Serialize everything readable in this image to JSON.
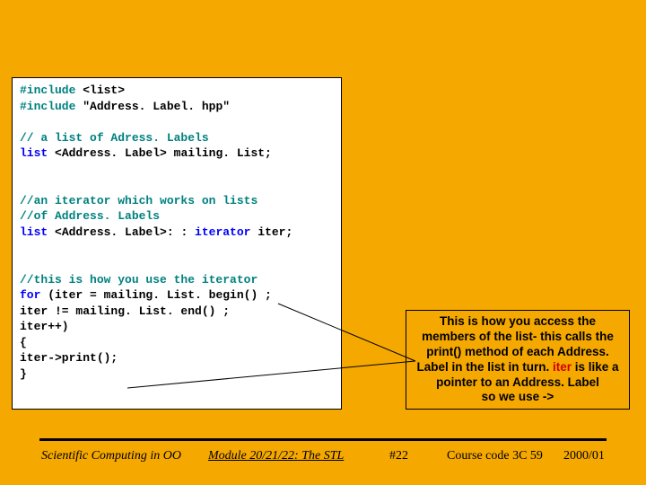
{
  "code": {
    "l1a": "#include",
    "l1b": " <list>",
    "l2a": "#include",
    "l2b": " \"Address. Label. hpp\"",
    "c1": "// a list of Adress. Labels",
    "l3a": "list",
    "l3b": " <Address. Label> mailing. List;",
    "c2a": "//an iterator which works on lists",
    "c2b": "//of Address. Labels",
    "l4a": "list",
    "l4b": " <Address. Label>: : ",
    "l4c": "iterator",
    "l4d": " iter;",
    "c3": "//this is how you use the iterator",
    "l5a": "for",
    "l5b": " (iter  = mailing. List. begin() ;",
    "l6": "     iter != mailing. List. end() ;",
    "l7": "     iter++)",
    "l8": "{",
    "l9": "  iter->print();",
    "l10": "}"
  },
  "info": {
    "t1": "This is how you access the members of the list- this calls the print() method of each Address. Label in the list in turn. ",
    "hl": "iter",
    "t2": " is like a pointer to an Address. Label",
    "t3": "so we use ->"
  },
  "footer": {
    "left": "Scientific Computing in OO",
    "mid": "Module 20/21/22: The STL",
    "num": "#22",
    "course": "Course code 3C 59",
    "year": "2000/01"
  }
}
